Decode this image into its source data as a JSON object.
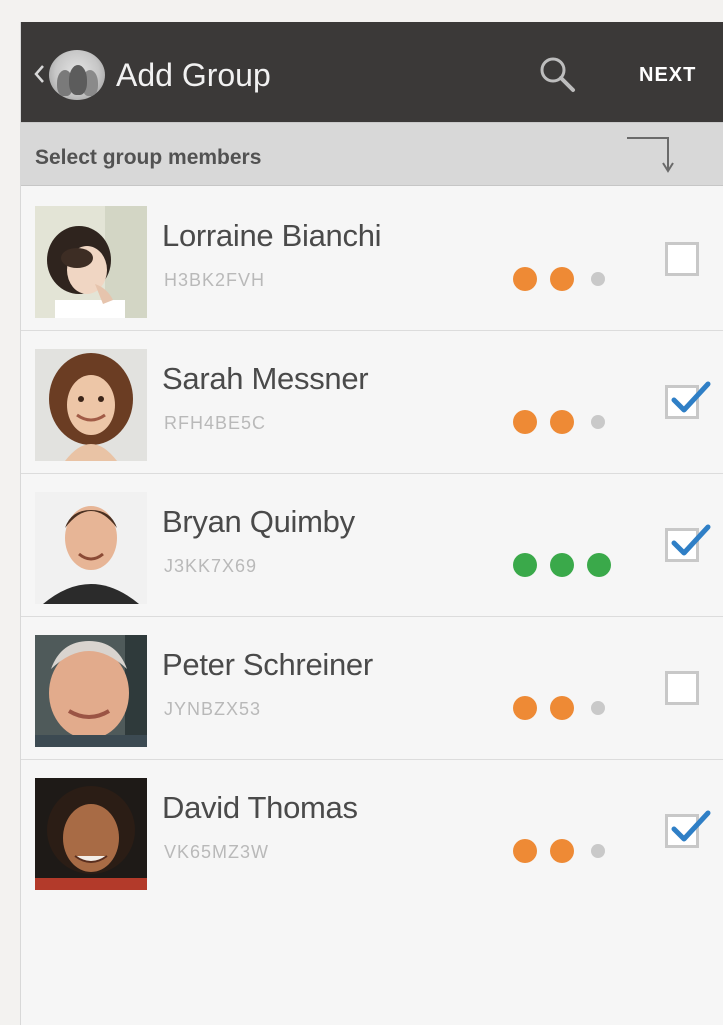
{
  "action_bar": {
    "title": "Add Group",
    "next_label": "NEXT",
    "background": "#3b3938"
  },
  "section": {
    "label": "Select group members"
  },
  "members": [
    {
      "name": "Lorraine Bianchi",
      "code": "H3BK2FVH",
      "status": [
        "orange",
        "orange",
        "gray"
      ],
      "checked": false
    },
    {
      "name": "Sarah Messner",
      "code": "RFH4BE5C",
      "status": [
        "orange",
        "orange",
        "gray"
      ],
      "checked": true
    },
    {
      "name": "Bryan Quimby",
      "code": "J3KK7X69",
      "status": [
        "green",
        "green",
        "green"
      ],
      "checked": true
    },
    {
      "name": "Peter Schreiner",
      "code": "JYNBZX53",
      "status": [
        "orange",
        "orange",
        "gray"
      ],
      "checked": false
    },
    {
      "name": "David Thomas",
      "code": "VK65MZ3W",
      "status": [
        "orange",
        "orange",
        "gray"
      ],
      "checked": true
    }
  ],
  "colors": {
    "orange": "#ee8a35",
    "green": "#3aa94a",
    "gray": "#c9c9c9",
    "check": "#2f7fc6"
  },
  "icons": [
    "back-icon",
    "app-icon",
    "search-icon",
    "sort-icon",
    "checkbox",
    "checkmark-icon"
  ]
}
